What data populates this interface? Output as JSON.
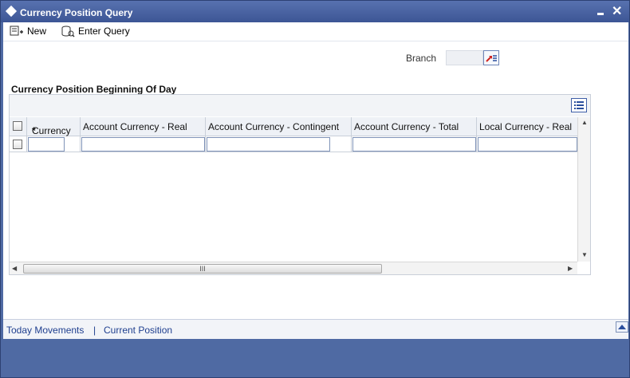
{
  "window": {
    "title": "Currency Position Query"
  },
  "toolbar": {
    "new_label": "New",
    "enter_query_label": "Enter Query"
  },
  "branch": {
    "label": "Branch",
    "value": ""
  },
  "section": {
    "title": "Currency Position Beginning Of Day"
  },
  "grid": {
    "columns": [
      {
        "label": "Currency",
        "required": "*"
      },
      {
        "label": "Account Currency - Real"
      },
      {
        "label": "Account Currency - Contingent"
      },
      {
        "label": "Account Currency - Total"
      },
      {
        "label": "Local Currency - Real"
      }
    ],
    "rows": [
      {
        "currency": "",
        "acc_real": "",
        "acc_contingent": "",
        "acc_total": "",
        "local_real": ""
      }
    ],
    "hscroll_grip": "III"
  },
  "footer": {
    "today_movements": "Today Movements",
    "separator": "|",
    "current_position": "Current Position"
  },
  "colors": {
    "title_bar": "#3c5595",
    "link": "#1f3f8f",
    "background": "#4f6aa3"
  }
}
